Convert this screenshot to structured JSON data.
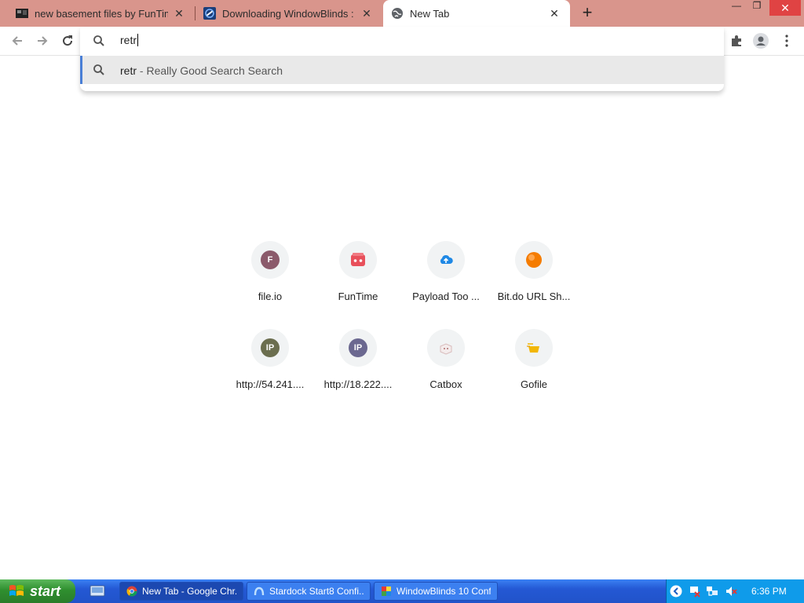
{
  "tabs": [
    {
      "title": "new basement files by FunTime",
      "favicon": "film-icon"
    },
    {
      "title": "Downloading WindowBlinds : Soi",
      "favicon": "stardock-icon"
    },
    {
      "title": "New Tab",
      "favicon": "globe-icon",
      "active": true
    }
  ],
  "tab_close_glyph": "✕",
  "newtab_glyph": "+",
  "window_controls": {
    "minimize": "—",
    "maximize": "❐",
    "close": "✕"
  },
  "omnibox": {
    "text": "retr",
    "suggestion": {
      "query": "retr",
      "separator": " - ",
      "description": "Really Good Search Search"
    }
  },
  "shortcuts": [
    {
      "label": "file.io",
      "badge": "F",
      "color": "#8b5a6b"
    },
    {
      "label": "FunTime",
      "icon": "gamepad-icon",
      "color": "#e8505b"
    },
    {
      "label": "Payload Too ...",
      "icon": "cloud-upload-icon",
      "color": "#1e88e5"
    },
    {
      "label": "Bit.do URL Sh...",
      "icon": "orange-ball-icon",
      "color": "#f57c00"
    },
    {
      "label": "http://54.241....",
      "badge": "IP",
      "color": "#6b6e4f"
    },
    {
      "label": "http://18.222....",
      "badge": "IP",
      "color": "#6b6890"
    },
    {
      "label": "Catbox",
      "icon": "catbox-icon",
      "color": "#e0c9c9"
    },
    {
      "label": "Gofile",
      "icon": "gofile-icon",
      "color": "#f2b705"
    }
  ],
  "taskbar": {
    "start_label": "start",
    "tasks": [
      {
        "label": "New Tab - Google Chr...",
        "icon": "chrome-icon",
        "active": true
      },
      {
        "label": "Stardock Start8 Confi...",
        "icon": "stardock-icon"
      },
      {
        "label": "WindowBlinds 10 Conf...",
        "icon": "windowblinds-icon"
      }
    ],
    "clock": "6:36 PM"
  }
}
